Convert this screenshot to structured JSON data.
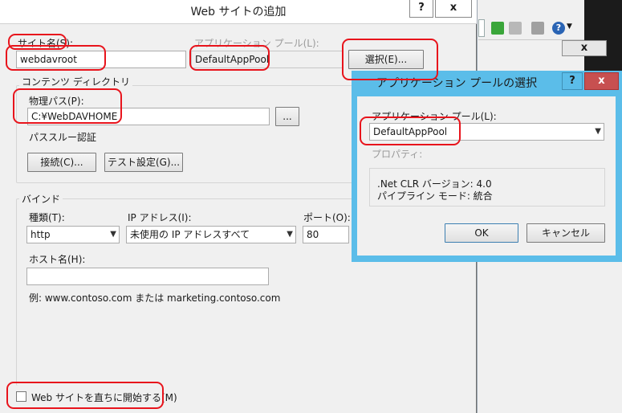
{
  "main_dialog": {
    "title": "Web サイトの追加",
    "help": "?",
    "close": "x",
    "site_name_label": "サイト名(S):",
    "site_name_value": "webdavroot",
    "app_pool_label": "アプリケーション プール(L):",
    "app_pool_value": "DefaultAppPool",
    "select_button": "選択(E)...",
    "content_dir_group": "コンテンツ ディレクトリ",
    "physical_path_label": "物理パス(P):",
    "physical_path_value": "C:¥WebDAVHOME",
    "browse_button": "...",
    "pass_through_label": "パススルー認証",
    "connect_button": "接続(C)...",
    "test_settings_button": "テスト設定(G)...",
    "binding_group": "バインド",
    "type_label": "種類(T):",
    "type_value": "http",
    "ip_label": "IP アドレス(I):",
    "ip_value": "未使用の IP アドレスすべて",
    "port_label": "ポート(O):",
    "port_value": "80",
    "host_label": "ホスト名(H):",
    "host_value": "",
    "example_text": "例: www.contoso.com または marketing.contoso.com",
    "start_checkbox_label": "Web サイトを直ちに開始する(M)"
  },
  "pool_dialog": {
    "title": "アプリケーション プールの選択",
    "help": "?",
    "close": "x",
    "pool_label": "アプリケーション プール(L):",
    "pool_value": "DefaultAppPool",
    "properties_label": "プロパティ:",
    "clr_version": ".Net CLR バージョン: 4.0",
    "pipeline_mode": "パイプライン モード: 統合",
    "ok_button": "OK",
    "cancel_button": "キャンセル"
  },
  "background_window": {
    "close": "x"
  },
  "colors": {
    "annotation": "#e8141c",
    "pool_titlebar": "#5bbde9",
    "close_red": "#c75050"
  }
}
